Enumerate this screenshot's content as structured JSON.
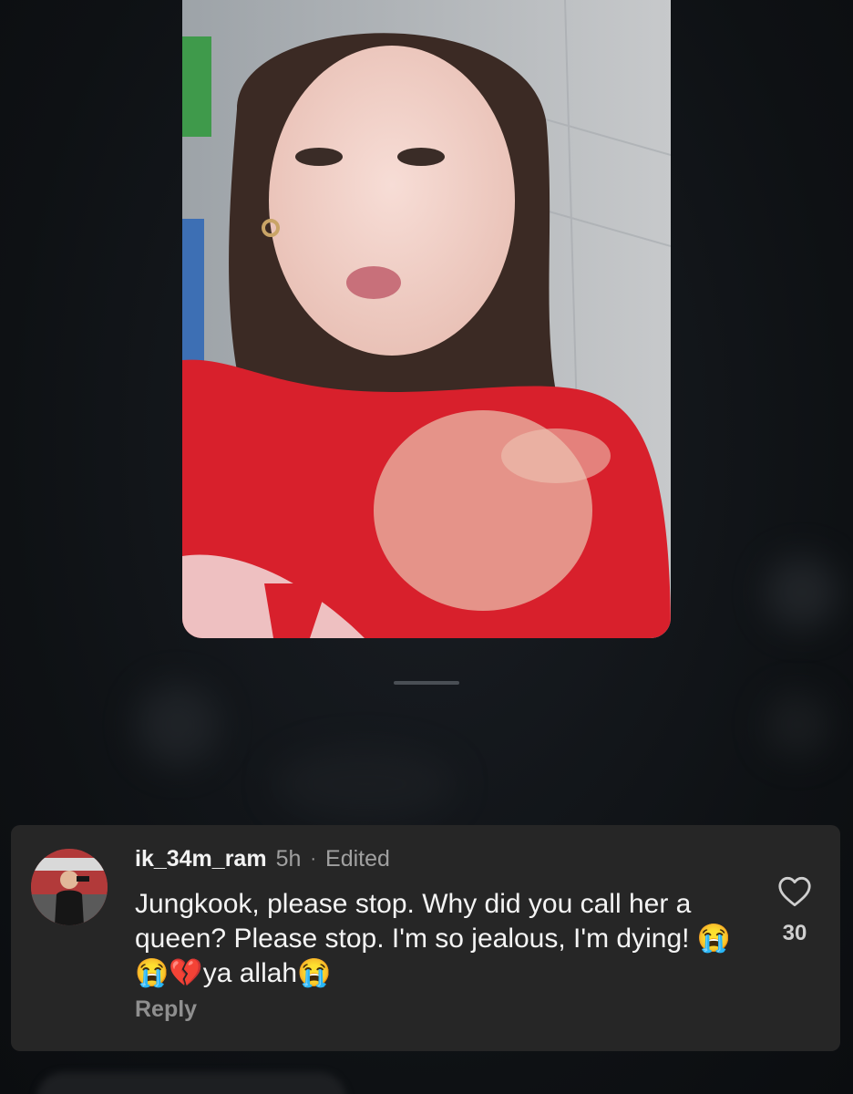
{
  "comment": {
    "username": "ik_34m_ram",
    "time": "5h",
    "separator": "·",
    "edited_label": "Edited",
    "text": "Jungkook, please stop. Why did you call her a queen? Please stop. I'm so jealous, I'm dying! 😭😭💔ya allah😭",
    "reply_label": "Reply",
    "like_count": "30"
  },
  "icons": {
    "like": "heart-outline-icon",
    "avatar": "profile-photo"
  },
  "colors": {
    "background": "#0f1216",
    "card": "#262626",
    "text_primary": "#f4f4f4",
    "text_secondary": "#a0a0a0"
  }
}
